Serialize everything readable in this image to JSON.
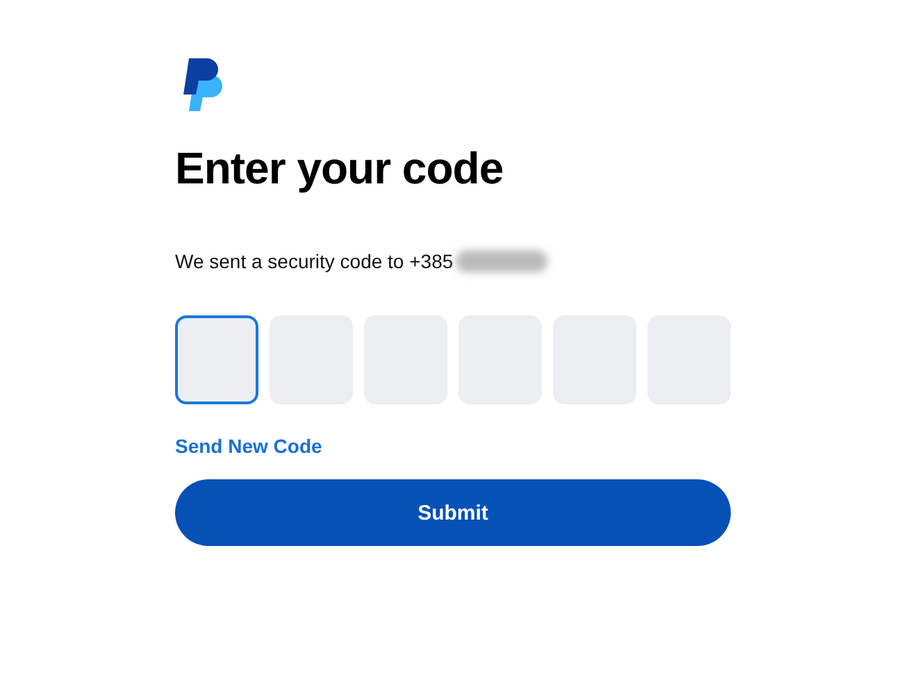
{
  "heading": "Enter your code",
  "message": {
    "text": "We sent a security code to +385",
    "redacted": true
  },
  "code_boxes": [
    {
      "focused": true
    },
    {
      "focused": false
    },
    {
      "focused": false
    },
    {
      "focused": false
    },
    {
      "focused": false
    },
    {
      "focused": false
    }
  ],
  "resend_link": "Send New Code",
  "submit_button": "Submit"
}
